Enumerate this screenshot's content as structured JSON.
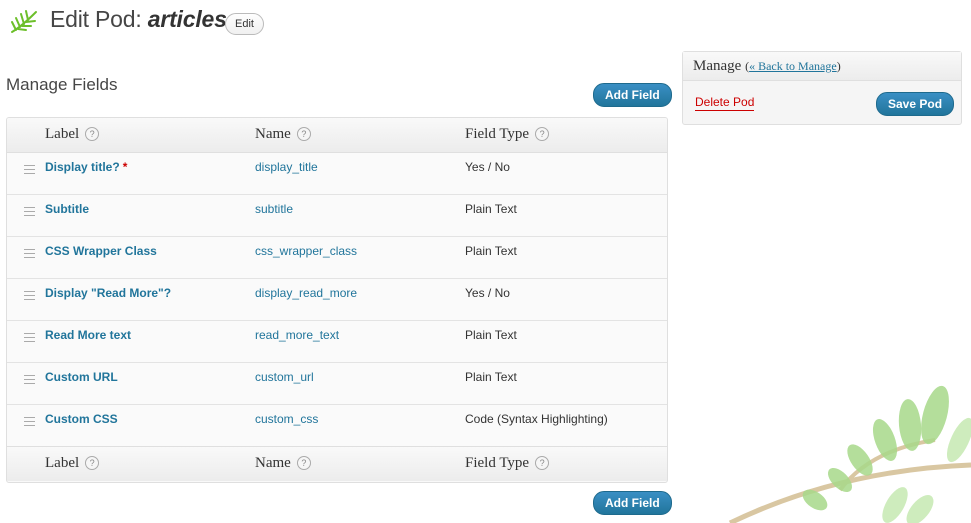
{
  "header": {
    "title_prefix": "Edit Pod:",
    "pod_name": "articles",
    "edit_label": "Edit"
  },
  "section": {
    "title": "Manage Fields",
    "add_field_label": "Add Field"
  },
  "table": {
    "columns": [
      "Label",
      "Name",
      "Field Type"
    ],
    "help_glyph": "?",
    "rows": [
      {
        "label": "Display title?",
        "required": "*",
        "name": "display_title",
        "type": "Yes / No"
      },
      {
        "label": "Subtitle",
        "required": "",
        "name": "subtitle",
        "type": "Plain Text"
      },
      {
        "label": "CSS Wrapper Class",
        "required": "",
        "name": "css_wrapper_class",
        "type": "Plain Text"
      },
      {
        "label": "Display \"Read More\"?",
        "required": "",
        "name": "display_read_more",
        "type": "Yes / No"
      },
      {
        "label": "Read More text",
        "required": "",
        "name": "read_more_text",
        "type": "Plain Text"
      },
      {
        "label": "Custom URL",
        "required": "",
        "name": "custom_url",
        "type": "Plain Text"
      },
      {
        "label": "Custom CSS",
        "required": "",
        "name": "custom_css",
        "type": "Code (Syntax Highlighting)"
      }
    ]
  },
  "manage": {
    "title": "Manage",
    "back_open": "(",
    "back_label": "« Back to Manage",
    "back_close": ")",
    "delete_label": "Delete Pod",
    "save_label": "Save Pod"
  },
  "colors": {
    "link": "#21759b",
    "primary_button": "#21759b",
    "danger": "#cc0000"
  }
}
